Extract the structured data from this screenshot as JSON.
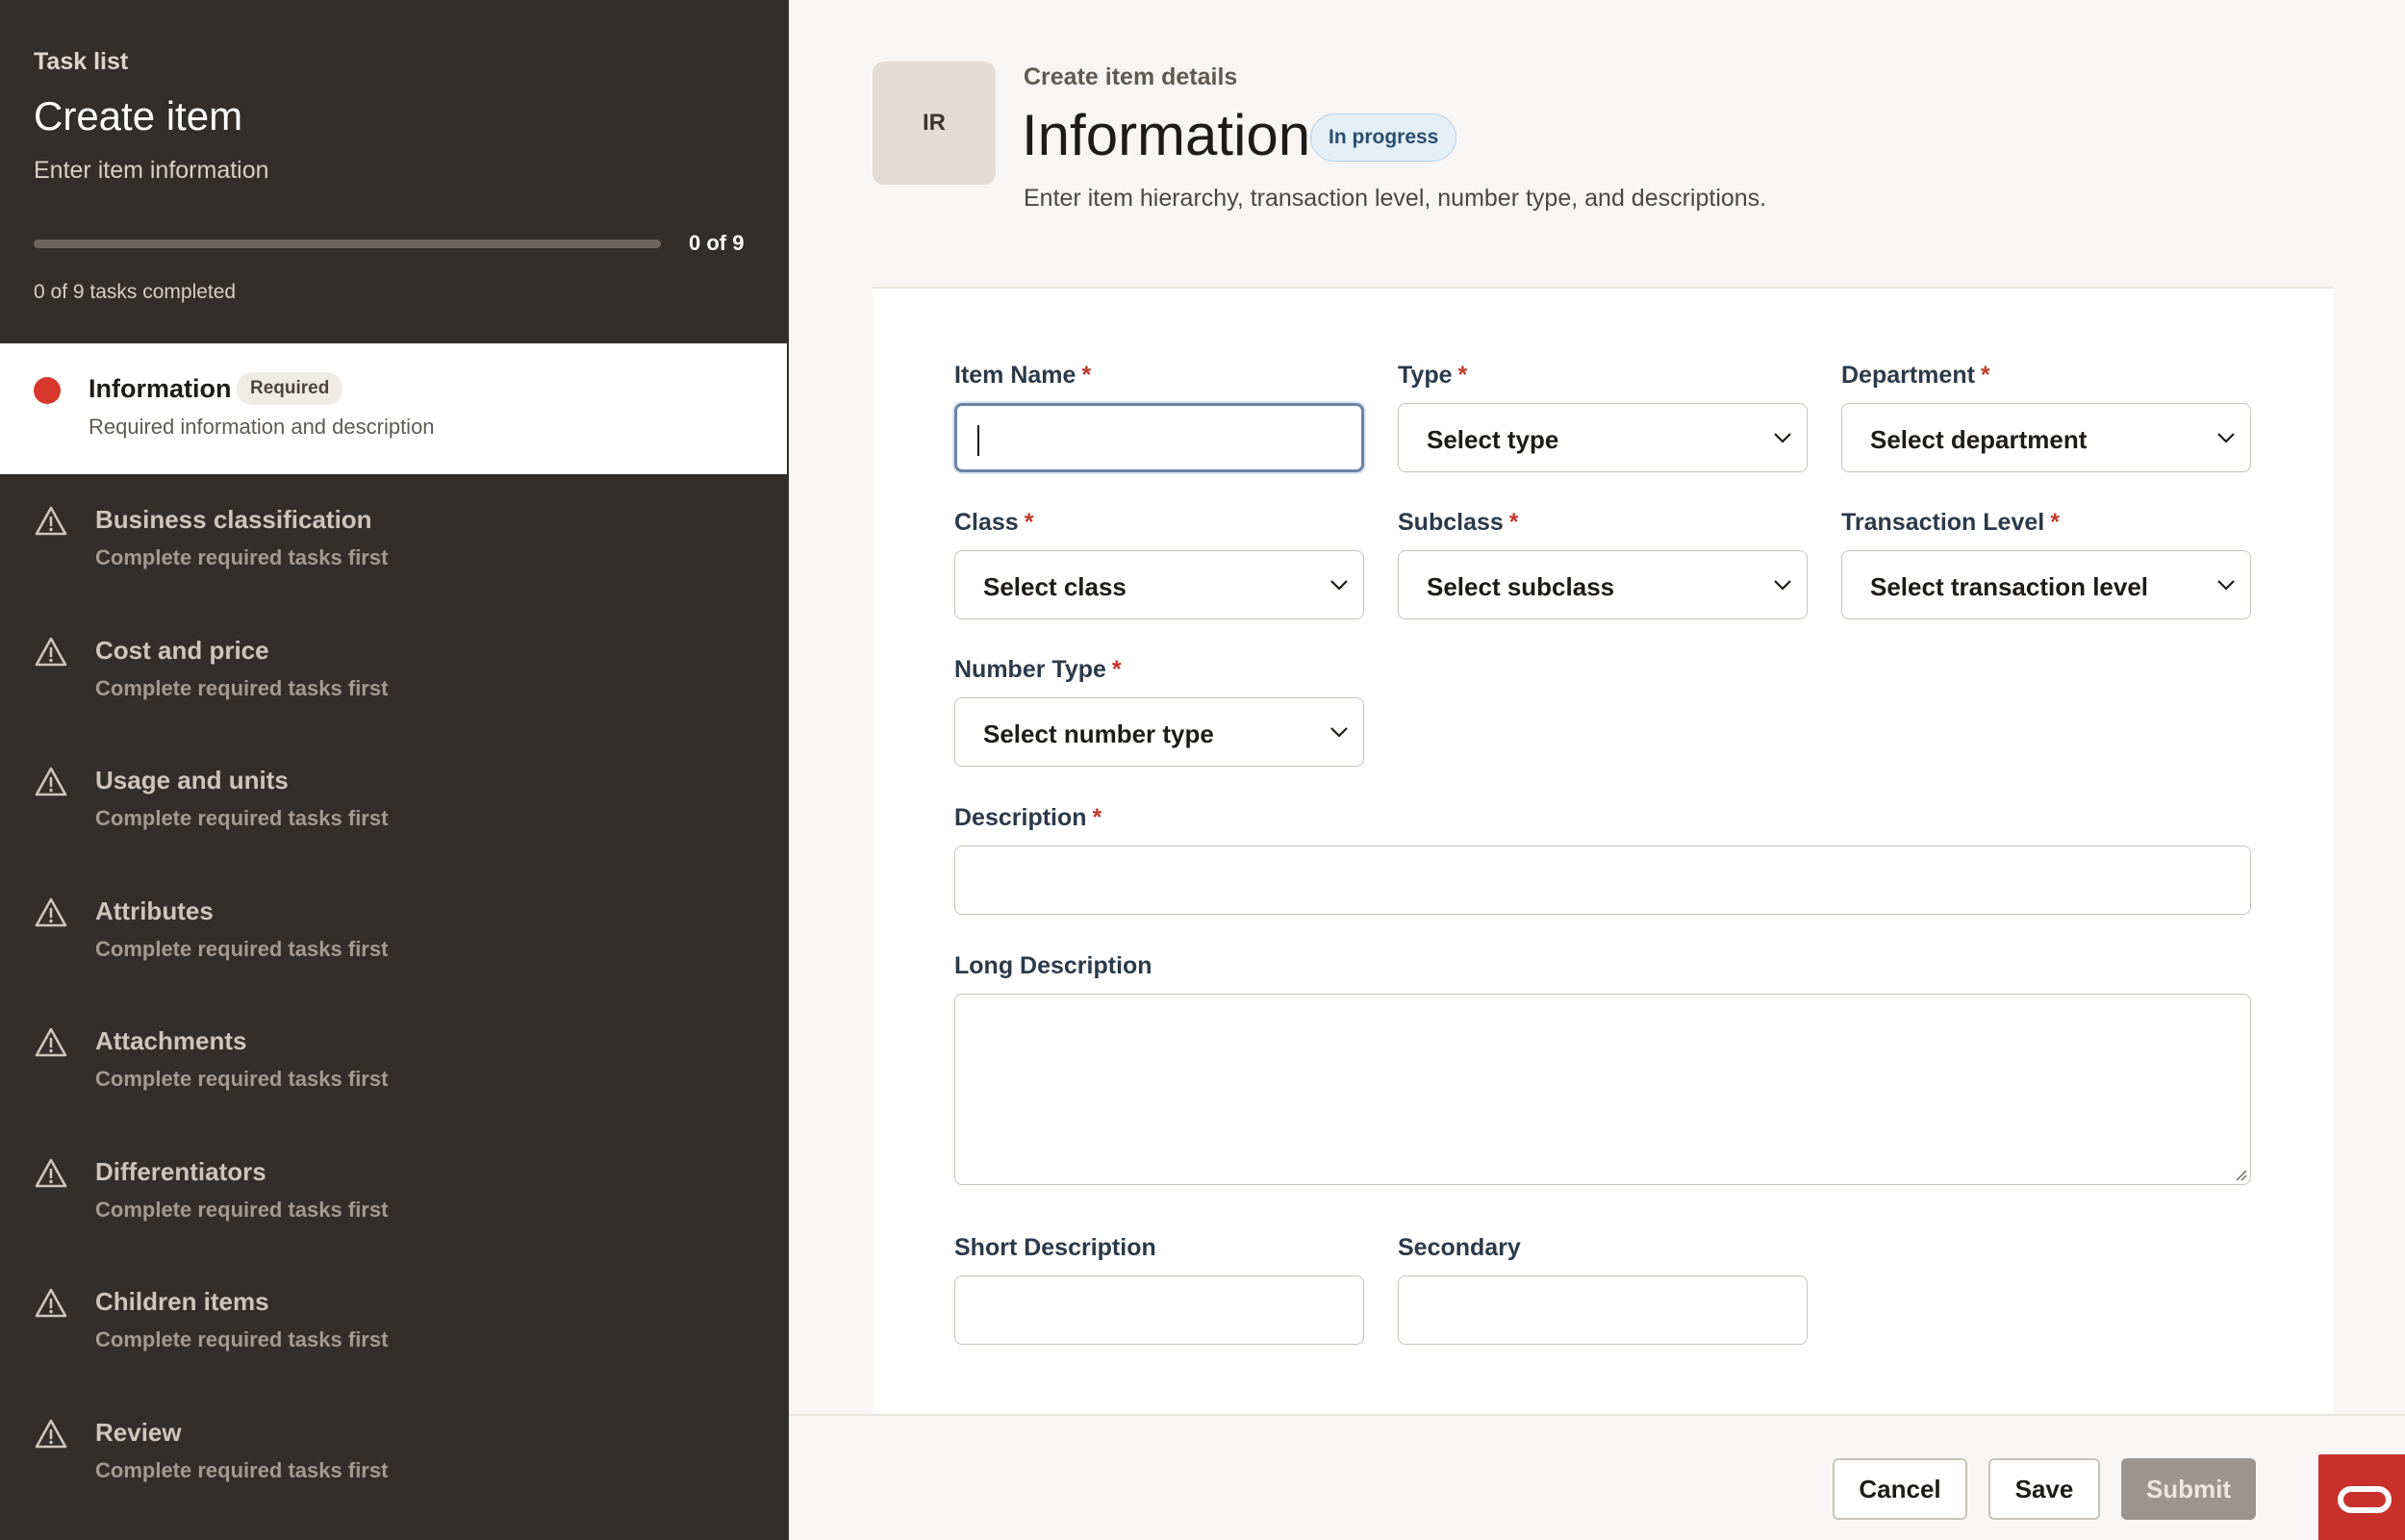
{
  "sidebar": {
    "kicker": "Task list",
    "title": "Create item",
    "subtitle": "Enter item information",
    "progress": {
      "count_label": "0 of 9",
      "completed_label": "0 of 9 tasks completed",
      "fraction": 0
    },
    "active_task": {
      "label": "Information",
      "badge": "Required",
      "description": "Required information and description"
    },
    "tasks": [
      {
        "label": "Business classification",
        "description": "Complete required tasks first"
      },
      {
        "label": "Cost and price",
        "description": "Complete required tasks first"
      },
      {
        "label": "Usage and units",
        "description": "Complete required tasks first"
      },
      {
        "label": "Attributes",
        "description": "Complete required tasks first"
      },
      {
        "label": "Attachments",
        "description": "Complete required tasks first"
      },
      {
        "label": "Differentiators",
        "description": "Complete required tasks first"
      },
      {
        "label": "Children items",
        "description": "Complete required tasks first"
      },
      {
        "label": "Review",
        "description": "Complete required tasks first"
      }
    ]
  },
  "header": {
    "avatar_initials": "IR",
    "eyebrow": "Create item details",
    "title": "Information",
    "status": "In progress",
    "description": "Enter item hierarchy, transaction level, number type, and descriptions."
  },
  "form": {
    "required_marker": "*",
    "item_name": {
      "label": "Item Name",
      "value": ""
    },
    "type": {
      "label": "Type",
      "selected": "Select type"
    },
    "department": {
      "label": "Department",
      "selected": "Select department"
    },
    "class": {
      "label": "Class",
      "selected": "Select class"
    },
    "subclass": {
      "label": "Subclass",
      "selected": "Select subclass"
    },
    "transaction_level": {
      "label": "Transaction Level",
      "selected": "Select transaction level"
    },
    "number_type": {
      "label": "Number Type",
      "selected": "Select number type"
    },
    "description": {
      "label": "Description",
      "value": ""
    },
    "long_description": {
      "label": "Long Description",
      "value": ""
    },
    "short_description": {
      "label": "Short Description",
      "value": ""
    },
    "secondary": {
      "label": "Secondary",
      "value": ""
    }
  },
  "footer": {
    "cancel_label": "Cancel",
    "save_label": "Save",
    "submit_label": "Submit"
  },
  "colors": {
    "sidebar_bg": "#322e2b",
    "status_dot": "#d7382b",
    "required_star": "#c2382c",
    "brand": "#c9302c"
  }
}
